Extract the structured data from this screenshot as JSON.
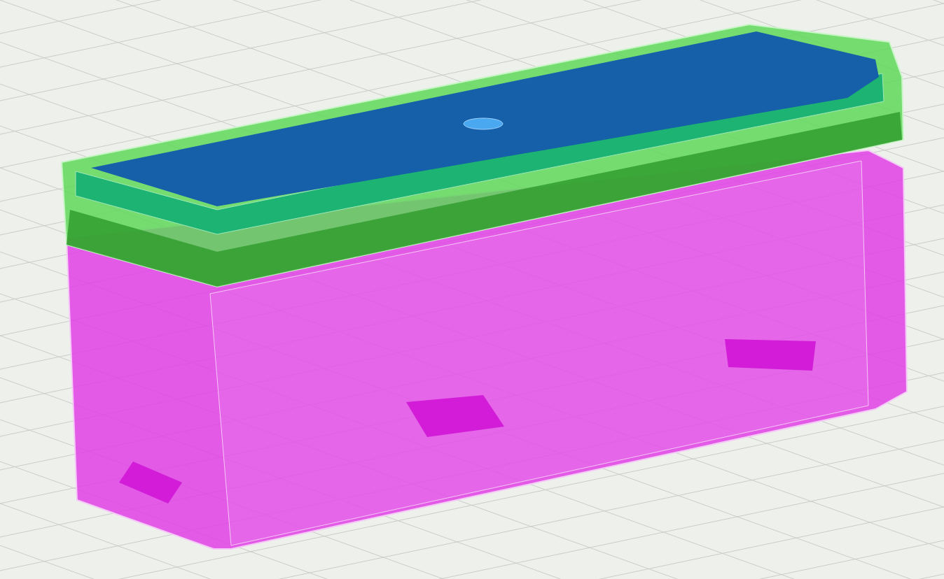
{
  "viewport": {
    "grid": true
  },
  "model": {
    "parts": [
      {
        "kind": "body",
        "color": "#e040e6"
      },
      {
        "kind": "lid",
        "color": "#5fd85a"
      },
      {
        "kind": "board",
        "color": "#1560a8"
      }
    ]
  }
}
